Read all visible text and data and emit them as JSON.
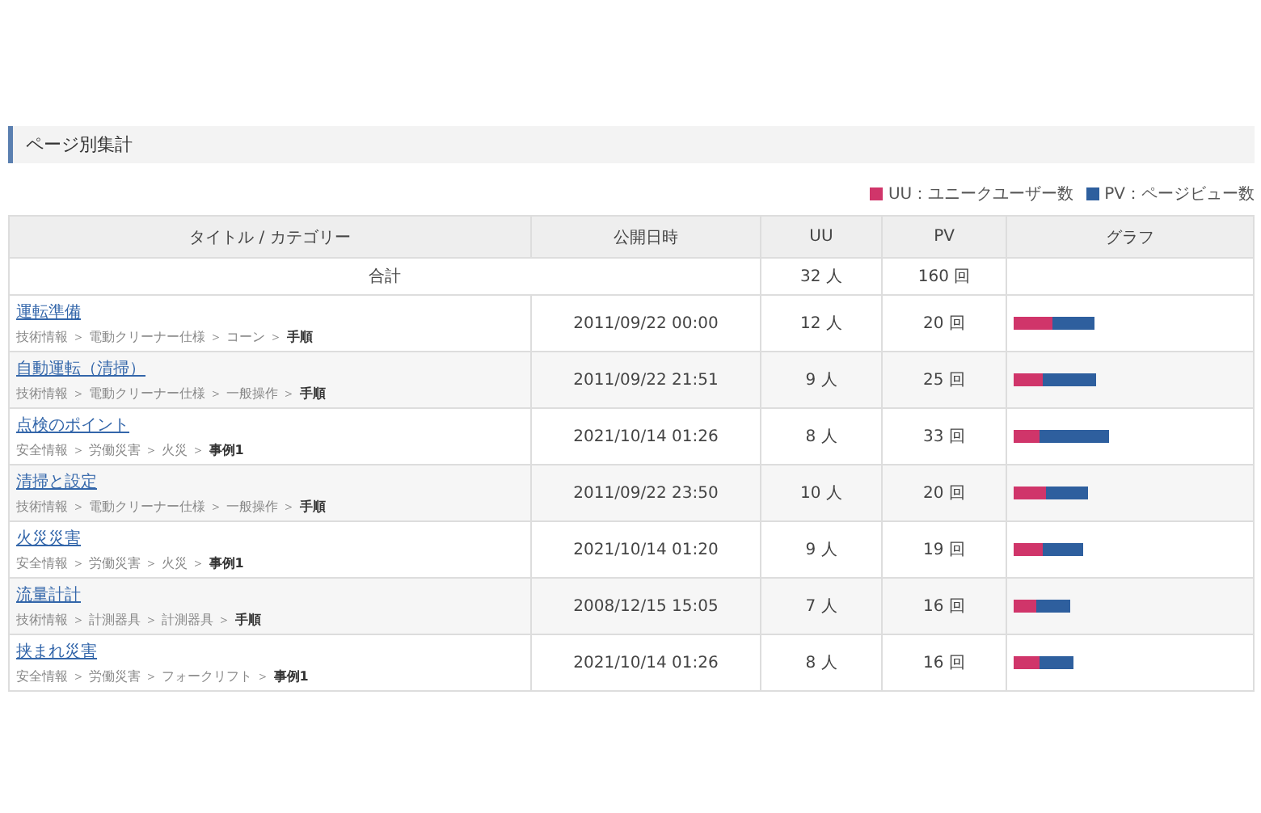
{
  "section_title": "ページ別集計",
  "legend": [
    {
      "label": "UU：ユニークユーザー数",
      "color": "#d0356a"
    },
    {
      "label": "PV：ページビュー数",
      "color": "#2e5f9e"
    }
  ],
  "table": {
    "columns": [
      "タイトル / カテゴリー",
      "公開日時",
      "UU",
      "PV",
      "グラフ"
    ],
    "total": {
      "label": "合計",
      "uu": "32 人",
      "pv": "160 回"
    },
    "rows": [
      {
        "title": "運転準備",
        "category": "技術情報 ＞ 電動クリーナー仕様 ＞ コーン ＞ **手順**",
        "date": "2011/09/22 00:00",
        "uu": "12 人",
        "pv": "20 回"
      },
      {
        "title": "自動運転（清掃）",
        "category": "技術情報 ＞ 電動クリーナー仕様 ＞ 一般操作 ＞ **手順**",
        "date": "2011/09/22 21:51",
        "uu": "9 人",
        "pv": "25 回"
      },
      {
        "title": "点検のポイント",
        "category": "安全情報 ＞ 労働災害 ＞ 火災 ＞ **事例1**",
        "date": "2021/10/14 01:26",
        "uu": "8 人",
        "pv": "33 回"
      },
      {
        "title": "清掃と設定",
        "category": "技術情報 ＞ 電動クリーナー仕様 ＞ 一般操作 ＞ **手順**",
        "date": "2011/09/22 23:50",
        "uu": "10 人",
        "pv": "20 回"
      },
      {
        "title": "火災災害",
        "category": "安全情報 ＞ 労働災害 ＞ 火災 ＞ **事例1**",
        "date": "2021/10/14 01:20",
        "uu": "9 人",
        "pv": "19 回"
      },
      {
        "title": "流量計計",
        "category": "技術情報 ＞ 計測器具 ＞ 計測器具 ＞ **手順**",
        "date": "2008/12/15 15:05",
        "uu": "7 人",
        "pv": "16 回"
      },
      {
        "title": "挟まれ災害",
        "category": "安全情報 ＞ 労働災害 ＞ フォークリフト ＞ **事例1**",
        "date": "2021/10/14 01:26",
        "uu": "8 人",
        "pv": "16 回"
      }
    ]
  }
}
